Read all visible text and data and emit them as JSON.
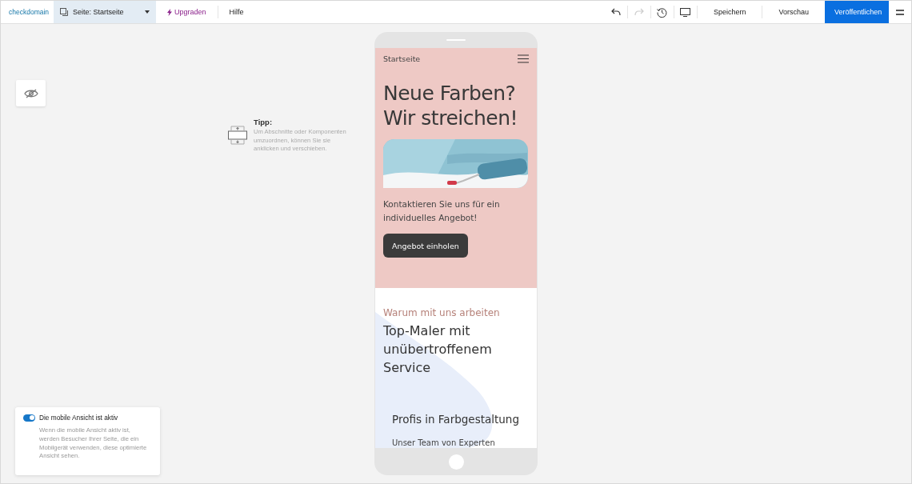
{
  "topbar": {
    "logo": "checkdomain",
    "page_selector": {
      "label": "Seite:",
      "value": "Startseite"
    },
    "upgrade": "Upgraden",
    "help": "Hilfe",
    "redo_disabled": true,
    "save": "Speichern",
    "preview": "Vorschau",
    "publish": "Veröffentlichen"
  },
  "tip": {
    "title": "Tipp:",
    "text": "Um Abschnitte oder Komponenten umzuordnen, können Sie sie anklicken und verschieben."
  },
  "mobile_notice": {
    "on": true,
    "title": "Die mobile Ansicht ist aktiv",
    "text": "Wenn die mobile Ansicht aktiv ist, werden Besucher Ihrer Seite, die ein Mobilgerät verwenden, diese optimierte Ansicht sehen."
  },
  "phone": {
    "nav_title": "Startseite",
    "hero_title": "Neue Farben? Wir streichen!",
    "hero_text": "Kontaktieren Sie uns für ein individuelles Angebot!",
    "cta": "Angebot einholen",
    "eyebrow": "Warum mit uns arbeiten",
    "section_title": "Top-Maler mit unübertroffenem Service",
    "feature_title": "Profis in Farbgestaltung",
    "feature_text": "Unser Team von Experten"
  }
}
